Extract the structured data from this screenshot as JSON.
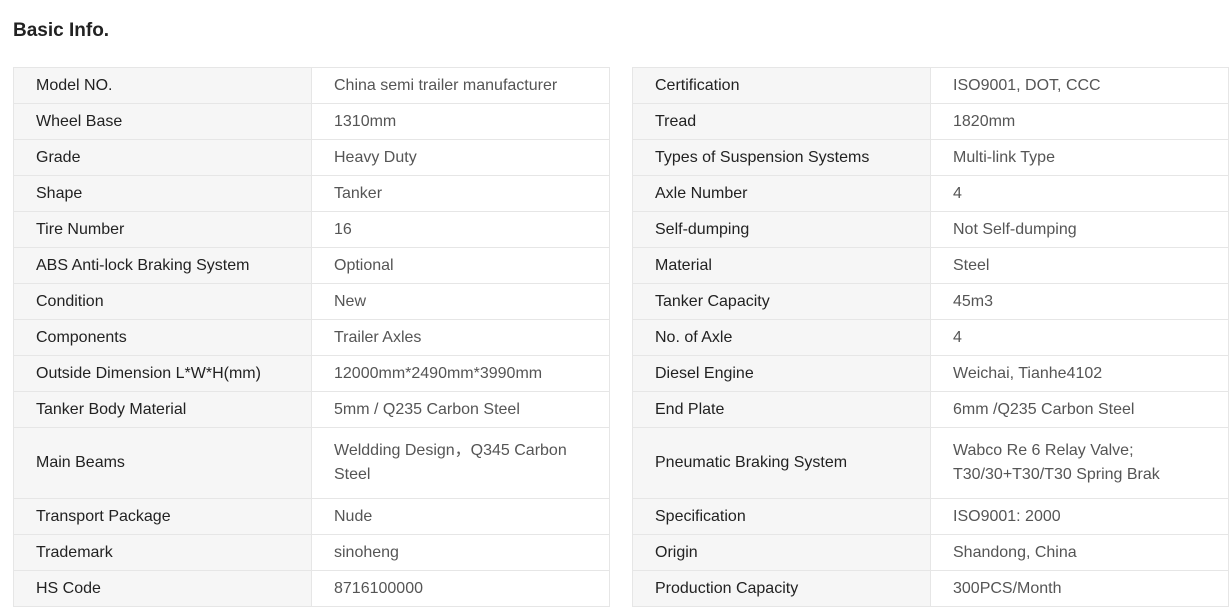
{
  "section": {
    "title": "Basic Info."
  },
  "left_table": [
    {
      "key": "Model NO.",
      "value": "China semi trailer manufacturer"
    },
    {
      "key": "Wheel Base",
      "value": "1310mm"
    },
    {
      "key": "Grade",
      "value": "Heavy Duty"
    },
    {
      "key": "Shape",
      "value": "Tanker"
    },
    {
      "key": "Tire Number",
      "value": "16"
    },
    {
      "key": "ABS Anti-lock Braking System",
      "value": "Optional"
    },
    {
      "key": "Condition",
      "value": "New"
    },
    {
      "key": "Components",
      "value": "Trailer Axles"
    },
    {
      "key": "Outside Dimension L*W*H(mm)",
      "value": "12000mm*2490mm*3990mm"
    },
    {
      "key": "Tanker Body Material",
      "value": "5mm / Q235 Carbon Steel"
    },
    {
      "key": "Main Beams",
      "value": "Weldding Design，Q345 Carbon Steel"
    },
    {
      "key": "Transport Package",
      "value": "Nude"
    },
    {
      "key": "Trademark",
      "value": "sinoheng"
    },
    {
      "key": "HS Code",
      "value": "8716100000"
    }
  ],
  "right_table": [
    {
      "key": "Certification",
      "value": "ISO9001, DOT, CCC"
    },
    {
      "key": "Tread",
      "value": "1820mm"
    },
    {
      "key": "Types of Suspension Systems",
      "value": "Multi-link Type"
    },
    {
      "key": "Axle Number",
      "value": "4"
    },
    {
      "key": "Self-dumping",
      "value": "Not Self-dumping"
    },
    {
      "key": "Material",
      "value": "Steel"
    },
    {
      "key": "Tanker Capacity",
      "value": "45m3"
    },
    {
      "key": "No. of Axle",
      "value": "4"
    },
    {
      "key": "Diesel Engine",
      "value": "Weichai, Tianhe4102"
    },
    {
      "key": "End Plate",
      "value": "6mm /Q235 Carbon Steel"
    },
    {
      "key": "Pneumatic Braking System",
      "value": "Wabco Re 6 Relay Valve; T30/30+T30/T30 Spring Brak"
    },
    {
      "key": "Specification",
      "value": "ISO9001: 2000"
    },
    {
      "key": "Origin",
      "value": "Shandong, China"
    },
    {
      "key": "Production Capacity",
      "value": "300PCS/Month"
    }
  ]
}
